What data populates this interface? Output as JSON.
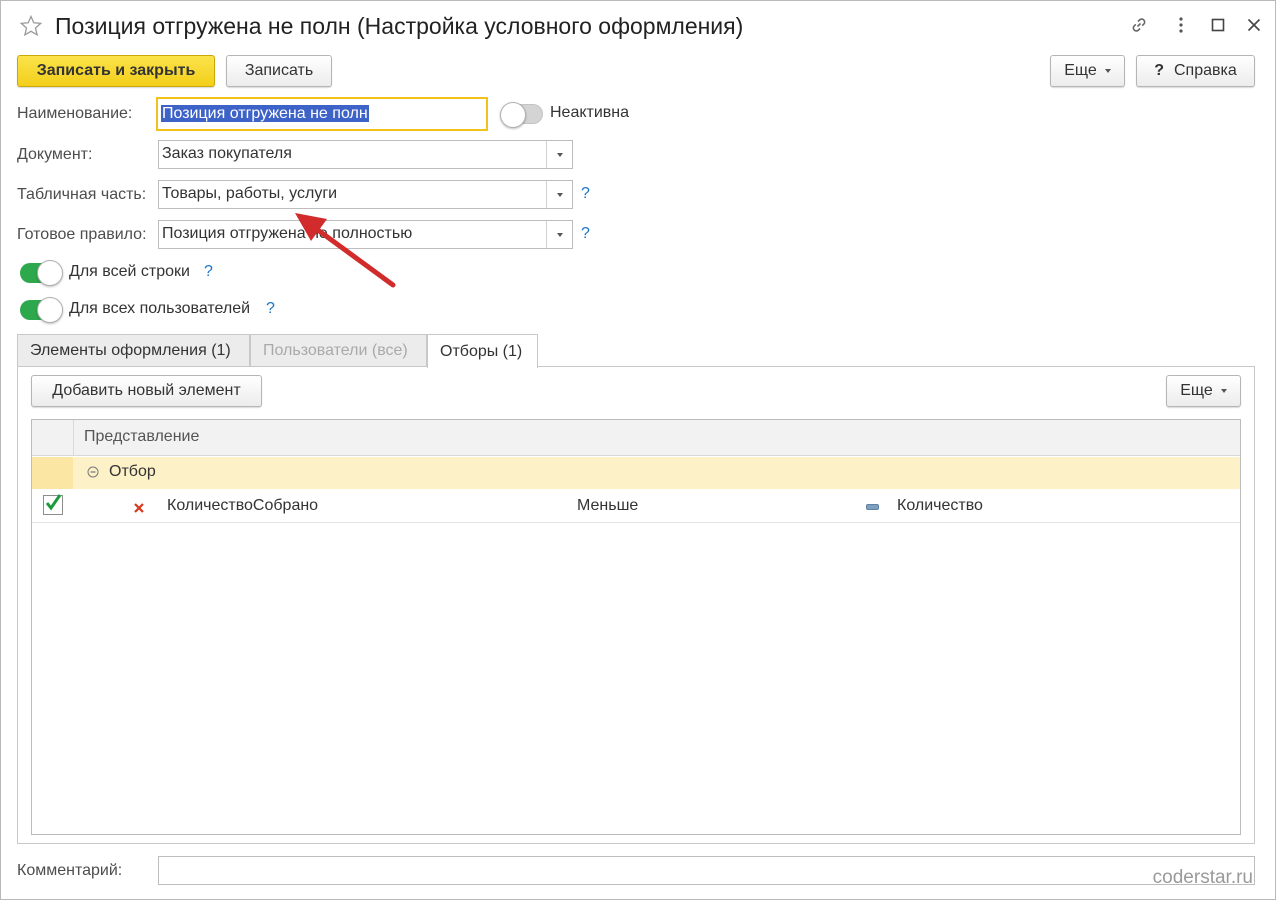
{
  "window": {
    "title": "Позиция отгружена не полн (Настройка условного оформления)"
  },
  "toolbar": {
    "save_close_label": "Записать и закрыть",
    "save_label": "Записать",
    "more_label": "Еще",
    "help_label": "Справка",
    "help_prefix": "?"
  },
  "form": {
    "name_label": "Наименование:",
    "name_value": "Позиция отгружена не полн",
    "inactive_label": "Неактивна",
    "document_label": "Документ:",
    "document_value": "Заказ покупателя",
    "tabular_label": "Табличная часть:",
    "tabular_value": "Товары, работы, услуги",
    "rule_label": "Готовое правило:",
    "rule_value": "Позиция отгружена не полностью",
    "help_mark": "?",
    "whole_row_label": "Для всей строки",
    "all_users_label": "Для всех пользователей",
    "comment_label": "Комментарий:",
    "comment_value": ""
  },
  "tabs": [
    {
      "label": "Элементы оформления (1)"
    },
    {
      "label": "Пользователи (все)"
    },
    {
      "label": "Отборы (1)"
    }
  ],
  "filters": {
    "add_button_label": "Добавить новый элемент",
    "more_label": "Еще",
    "column_header": "Представление",
    "group_label": "Отбор",
    "rows": [
      {
        "field": "КоличествоСобрано",
        "condition": "Меньше",
        "value": "Количество",
        "checked": true
      }
    ]
  },
  "watermark": "coderstar.ru",
  "colors": {
    "primary_button": "#f3cf1a",
    "toggle_on": "#2ea84d",
    "group_row": "#fdf2c7",
    "help_link": "#1b74c7",
    "arrow": "#d22b2b"
  }
}
